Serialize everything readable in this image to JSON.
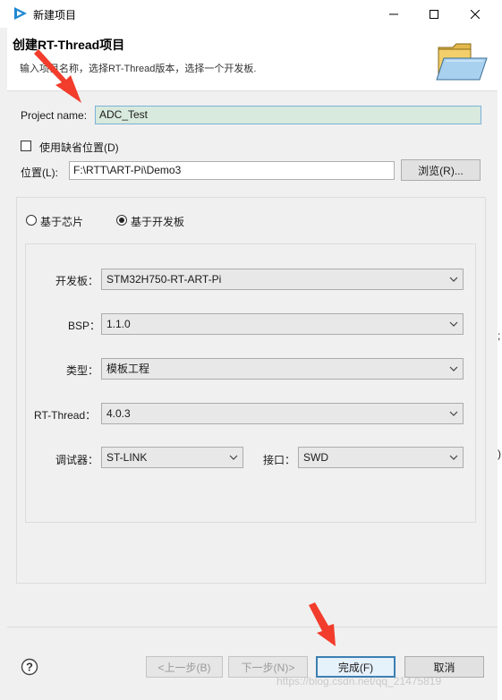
{
  "window": {
    "title": "新建项目"
  },
  "banner": {
    "title": "创建RT-Thread项目",
    "description": "输入项目名称，选择RT-Thread版本，选择一个开发板."
  },
  "project_name": {
    "label": "Project name:",
    "value": "ADC_Test"
  },
  "use_default_location": {
    "label": "使用缺省位置(D)",
    "checked": false
  },
  "location": {
    "label": "位置(L):",
    "value": "F:\\RTT\\ART-Pi\\Demo3",
    "browse_label": "浏览(R)..."
  },
  "base_options": {
    "chip_label": "基于芯片",
    "board_label": "基于开发板",
    "selected": "基于开发板"
  },
  "fields": {
    "board_label": "开发板：",
    "board_value": "STM32H750-RT-ART-Pi",
    "bsp_label": "BSP：",
    "bsp_value": "1.1.0",
    "type_label": "类型：",
    "type_value": "模板工程",
    "rtthread_label": "RT-Thread：",
    "rtthread_value": "4.0.3",
    "debugger_label": "调试器：",
    "debugger_value": "ST-LINK",
    "interface_label": "接口：",
    "interface_value": "SWD"
  },
  "buttons": {
    "back": "<上一步(B)",
    "next": "下一步(N)>",
    "finish": "完成(F)",
    "cancel": "取消"
  },
  "watermark": "https://blog.csdn.net/qq_21475819",
  "edge_glyphs": [
    ";",
    ")"
  ],
  "icons": {
    "app": "rt-thread-studio-icon",
    "banner": "open-folder-icon",
    "help": "help-icon"
  },
  "colors": {
    "focused_input_bg": "#d8e9dd",
    "primary_border": "#3c7fb1",
    "annotation_arrow": "#f23c2c"
  }
}
